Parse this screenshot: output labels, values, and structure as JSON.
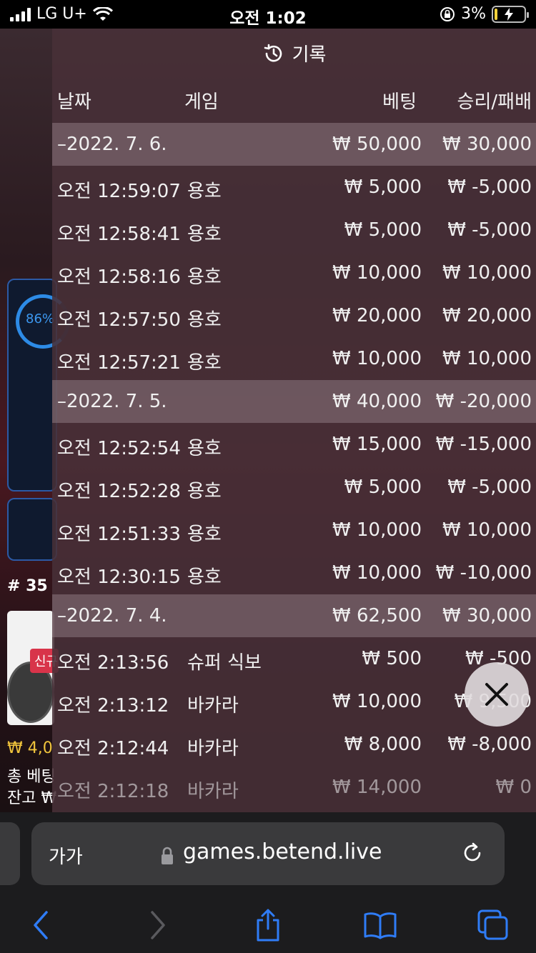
{
  "status_bar": {
    "carrier": "LG U+",
    "time": "오전 1:02",
    "battery": "3%"
  },
  "background_page": {
    "ring_percent": "86%",
    "list_number": "# 35",
    "new_badge": "신규",
    "amount": "₩ 4,0",
    "line1": "총 베팅",
    "line2": "잔고 ₩"
  },
  "history": {
    "title": "기록",
    "headers": {
      "date": "날짜",
      "game": "게임",
      "bet": "베팅",
      "result": "승리/패배"
    },
    "rows": [
      {
        "type": "date",
        "label": "–2022. 7. 6.",
        "bet": "₩ 50,000",
        "result": "₩ 30,000"
      },
      {
        "type": "entry",
        "time": "오전 12:59:07",
        "game": "용호",
        "bet": "₩ 5,000",
        "result": "₩ -5,000"
      },
      {
        "type": "entry",
        "time": "오전 12:58:41",
        "game": "용호",
        "bet": "₩ 5,000",
        "result": "₩ -5,000"
      },
      {
        "type": "entry",
        "time": "오전 12:58:16",
        "game": "용호",
        "bet": "₩ 10,000",
        "result": "₩ 10,000"
      },
      {
        "type": "entry",
        "time": "오전 12:57:50",
        "game": "용호",
        "bet": "₩ 20,000",
        "result": "₩ 20,000"
      },
      {
        "type": "entry",
        "time": "오전 12:57:21",
        "game": "용호",
        "bet": "₩ 10,000",
        "result": "₩ 10,000"
      },
      {
        "type": "date",
        "label": "–2022. 7. 5.",
        "bet": "₩ 40,000",
        "result": "₩ -20,000"
      },
      {
        "type": "entry",
        "time": "오전 12:52:54",
        "game": "용호",
        "bet": "₩ 15,000",
        "result": "₩ -15,000"
      },
      {
        "type": "entry",
        "time": "오전 12:52:28",
        "game": "용호",
        "bet": "₩ 5,000",
        "result": "₩ -5,000"
      },
      {
        "type": "entry",
        "time": "오전 12:51:33",
        "game": "용호",
        "bet": "₩ 10,000",
        "result": "₩ 10,000"
      },
      {
        "type": "entry",
        "time": "오전 12:30:15",
        "game": "용호",
        "bet": "₩ 10,000",
        "result": "₩ -10,000"
      },
      {
        "type": "date",
        "label": "–2022. 7. 4.",
        "bet": "₩ 62,500",
        "result": "₩ 30,000"
      },
      {
        "type": "entry",
        "time": "오전 2:13:56",
        "game": "슈퍼 식보",
        "bet": "₩ 500",
        "result": "₩ -500"
      },
      {
        "type": "entry",
        "time": "오전 2:13:12",
        "game": "바카라",
        "bet": "₩ 10,000",
        "result": "₩ 9,500"
      },
      {
        "type": "entry",
        "time": "오전 2:12:44",
        "game": "바카라",
        "bet": "₩ 8,000",
        "result": "₩ -8,000"
      },
      {
        "type": "entry",
        "time": "오전 2:12:18",
        "game": "바카라",
        "bet": "₩ 14,000",
        "result": "₩ 0"
      }
    ]
  },
  "browser": {
    "aa_label": "가가",
    "url": "games.betend.live"
  }
}
